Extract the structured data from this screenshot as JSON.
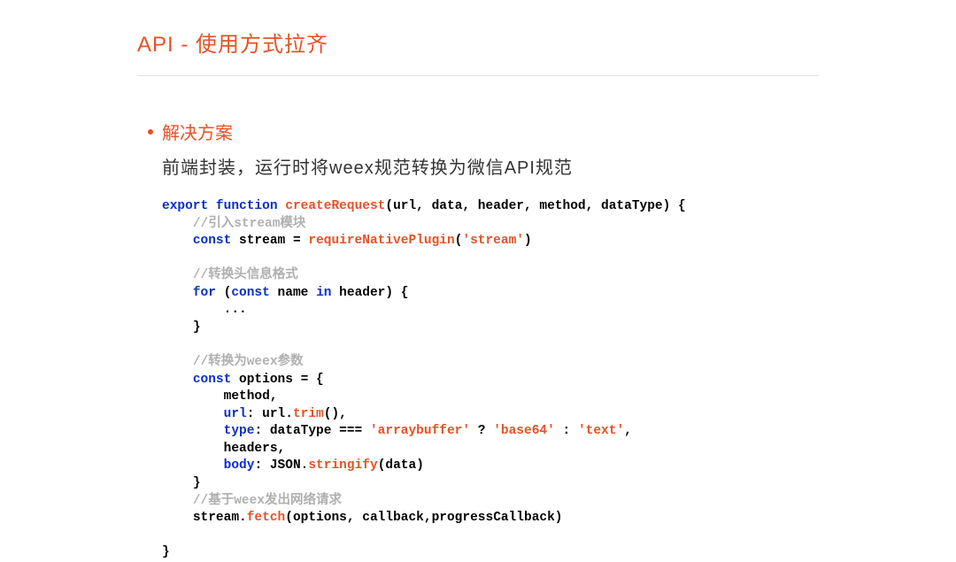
{
  "title": "API - 使用方式拉齐",
  "bullet": "解决方案",
  "subtitle": "前端封装，运行时将weex规范转换为微信API规范",
  "code": {
    "l01a": "export",
    "l01b": "function",
    "l01c": "createRequest",
    "l01d": "(url, data, header, method, dataType) {",
    "l02": "//引入stream模块",
    "l03a": "const",
    "l03b": " stream = ",
    "l03c": "requireNativePlugin",
    "l03d": "(",
    "l03e": "'stream'",
    "l03f": ")",
    "l04": "//转换头信息格式",
    "l05a": "for",
    "l05b": " (",
    "l05c": "const",
    "l05d": " name ",
    "l05e": "in",
    "l05f": " header) {",
    "l06": "...",
    "l07": "}",
    "l08": "//转换为weex参数",
    "l09a": "const",
    "l09b": " options = {",
    "l10": "method,",
    "l11a": "url",
    "l11b": ": url.",
    "l11c": "trim",
    "l11d": "(),",
    "l12a": "type",
    "l12b": ": dataType === ",
    "l12c": "'arraybuffer'",
    "l12d": " ? ",
    "l12e": "'base64'",
    "l12f": " : ",
    "l12g": "'text'",
    "l12h": ",",
    "l13": "headers,",
    "l14a": "body",
    "l14b": ": JSON.",
    "l14c": "stringify",
    "l14d": "(data)",
    "l15": "}",
    "l16": "//基于weex发出网络请求",
    "l17a": "stream.",
    "l17b": "fetch",
    "l17c": "(options, callback,progressCallback)",
    "l18": "}"
  }
}
